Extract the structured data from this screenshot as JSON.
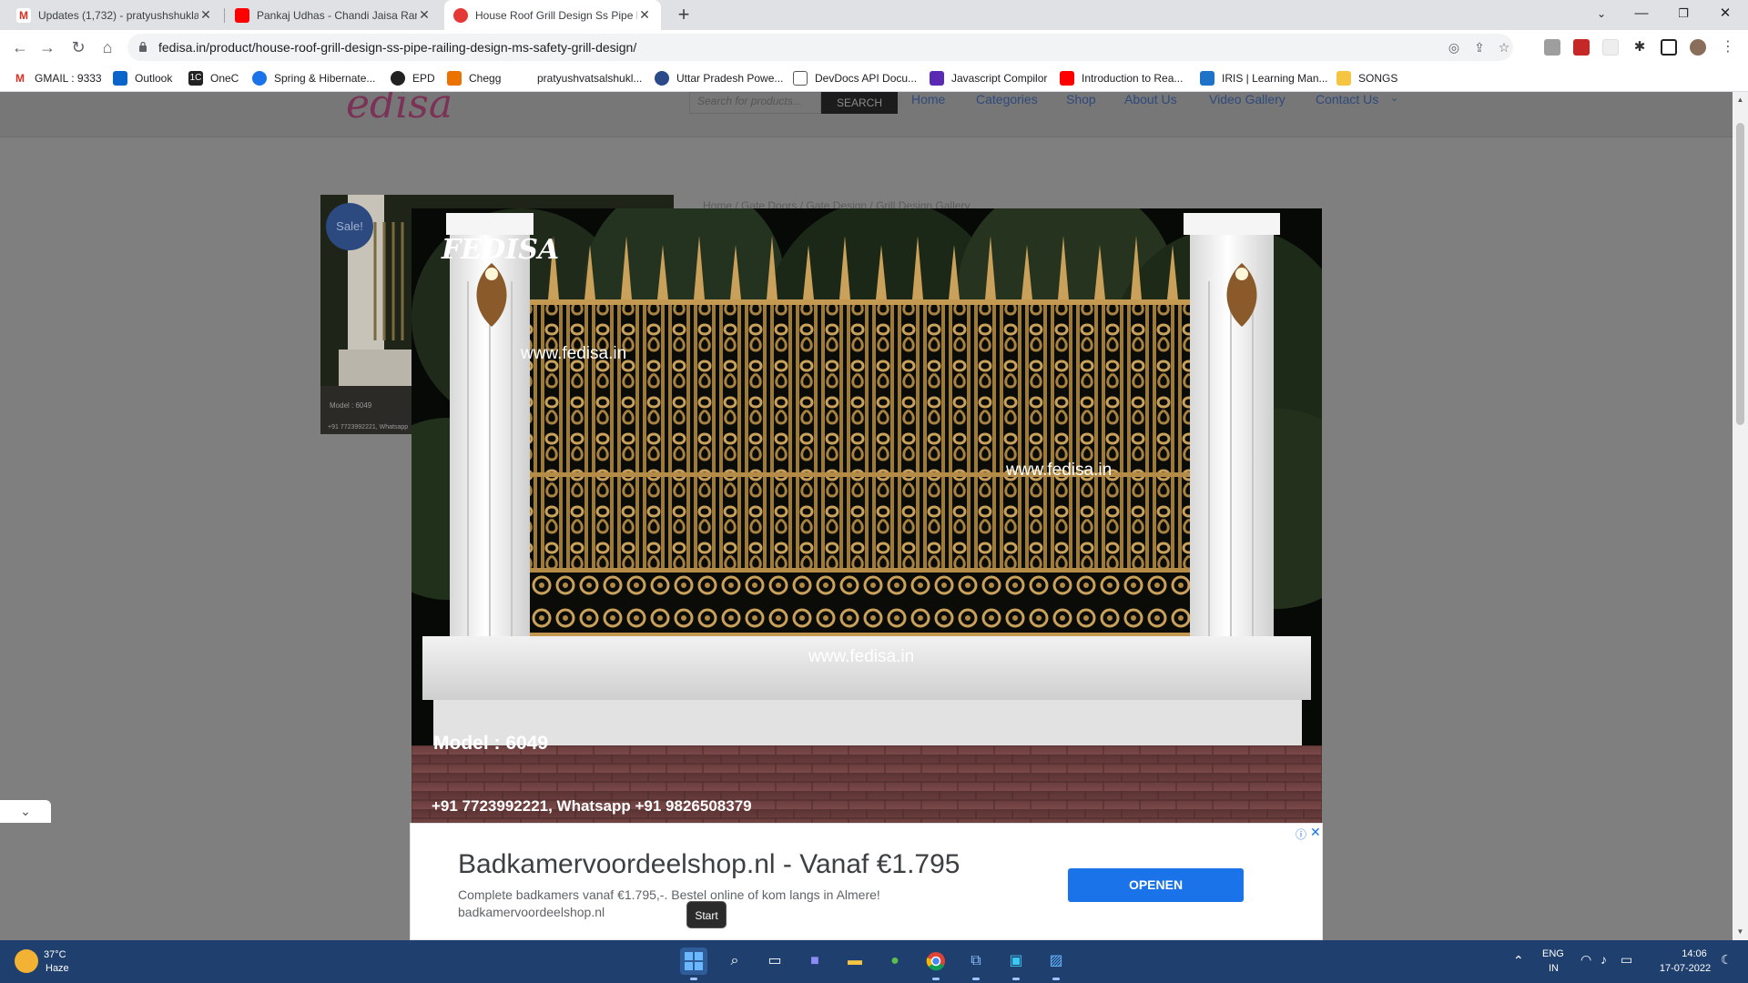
{
  "browser": {
    "tabs": [
      {
        "title": "Updates (1,732) - pratyushshukla",
        "favicon": "gmail-icon",
        "color": "#d93025"
      },
      {
        "title": "Pankaj Udhas - Chandi Jaisa Rang",
        "favicon": "youtube-icon",
        "color": "#ff0000"
      },
      {
        "title": "House Roof Grill Design Ss Pipe R",
        "favicon": "fedisa-icon",
        "color": "#e53935"
      }
    ],
    "url": "fedisa.in/product/house-roof-grill-design-ss-pipe-railing-design-ms-safety-grill-design/",
    "bookmarks": [
      {
        "label": "GMAIL : 9333",
        "icon": "gmail-icon",
        "color": "#d93025"
      },
      {
        "label": "Outlook",
        "icon": "outlook-icon",
        "color": "#0a64c9"
      },
      {
        "label": "OneC",
        "icon": "onec-icon",
        "color": "#222222"
      },
      {
        "label": "Spring & Hibernate...",
        "icon": "spring-icon",
        "color": "#1a73e8"
      },
      {
        "label": "EPD",
        "icon": "epd-icon",
        "color": "#222222"
      },
      {
        "label": "Chegg",
        "icon": "chegg-icon",
        "color": "#eb7100"
      },
      {
        "label": "pratyushvatsalshukl...",
        "icon": "blank-icon",
        "color": "#ffffff"
      },
      {
        "label": "Uttar Pradesh Powe...",
        "icon": "globe-icon",
        "color": "#2b4a8a"
      },
      {
        "label": "DevDocs API Docu...",
        "icon": "devdocs-icon",
        "color": "#555555"
      },
      {
        "label": "Javascript Compilor",
        "icon": "programiz-icon",
        "color": "#5a2ab5"
      },
      {
        "label": "Introduction to Rea...",
        "icon": "youtube-icon",
        "color": "#ff0000"
      },
      {
        "label": "IRIS | Learning Man...",
        "icon": "iris-icon",
        "color": "#1e73c9"
      },
      {
        "label": "SONGS",
        "icon": "folder-icon",
        "color": "#f5c542"
      }
    ]
  },
  "site": {
    "logo_text": "edisa",
    "search_placeholder": "Search for products...",
    "search_button": "SEARCH",
    "nav": [
      "Home",
      "Categories",
      "Shop",
      "About Us",
      "Video Gallery",
      "Contact Us"
    ],
    "sale_badge": "Sale!",
    "breadcrumb": "Home / Gate Doors / Gate Design / Grill Design Gallery",
    "thumb_model": "Model : 6049",
    "thumb_phone": "+91 7723992221, Whatsapp"
  },
  "lightbox": {
    "brand": "FEDISA",
    "watermark_1": "www.fedisa.in",
    "watermark_2": "www.fedisa.in",
    "watermark_3": "www.fedisa.in",
    "model": "Model : 6049",
    "contact": "+91 7723992221, Whatsapp +91 9826508379"
  },
  "ad": {
    "title": "Badkamervoordeelshop.nl - Vanaf €1.795",
    "description": "Complete badkamers vanaf €1.795,-. Bestel online of kom langs in Almere!",
    "url": "badkamervoordeelshop.nl",
    "button": "OPENEN"
  },
  "tooltip": "Start",
  "taskbar": {
    "weather_temp": "37°C",
    "weather_desc": "Haze",
    "lang_top": "ENG",
    "lang_bottom": "IN",
    "time": "14:06",
    "date": "17-07-2022"
  }
}
